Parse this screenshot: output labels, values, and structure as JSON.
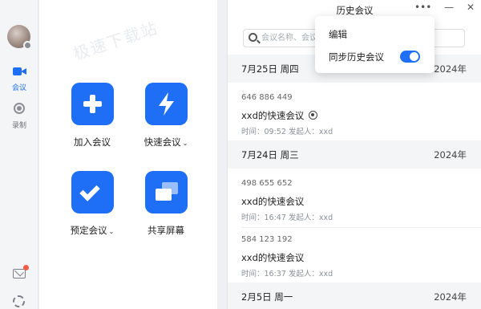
{
  "sidebar": {
    "nav": [
      {
        "label": "会议",
        "icon": "video-camera-icon",
        "active": true
      },
      {
        "label": "录制",
        "icon": "record-icon",
        "active": false
      }
    ],
    "bottom_icons": [
      "mail-icon",
      "settings-icon"
    ]
  },
  "main": {
    "watermark": "极速下载站",
    "actions": [
      {
        "label": "加入会议",
        "icon": "plus-icon",
        "has_dropdown": false
      },
      {
        "label": "快速会议",
        "icon": "lightning-icon",
        "has_dropdown": true
      },
      {
        "label": "预定会议",
        "icon": "check-icon",
        "has_dropdown": true
      },
      {
        "label": "共享屏幕",
        "icon": "share-screen-icon",
        "has_dropdown": false
      }
    ],
    "caret": "⌄"
  },
  "history": {
    "title": "历史会议",
    "window_buttons": {
      "more": "•••",
      "minimize": "—",
      "close": "✕"
    },
    "search_placeholder": "会议名称、会议号",
    "groups": [
      {
        "date": "7月25日 周四",
        "year": "2024年",
        "meetings": [
          {
            "id": "646 886 449",
            "title": "xxd的快速会议",
            "recorded": true,
            "meta": "时间：09:52  发起人：xxd"
          }
        ]
      },
      {
        "date": "7月24日 周三",
        "year": "2024年",
        "meetings": [
          {
            "id": "498 655 652",
            "title": "xxd的快速会议",
            "recorded": false,
            "meta": "时间：16:47  发起人：xxd"
          },
          {
            "id": "584 123 192",
            "title": "xxd的快速会议",
            "recorded": false,
            "meta": "时间：16:37  发起人：xxd"
          }
        ]
      },
      {
        "date": "2月5日 周一",
        "year": "2024年",
        "meetings": []
      }
    ]
  },
  "popup": {
    "edit_label": "编辑",
    "sync_label": "同步历史会议",
    "sync_enabled": true
  },
  "colors": {
    "accent": "#1e6ff5",
    "badge": "#f25c48"
  }
}
